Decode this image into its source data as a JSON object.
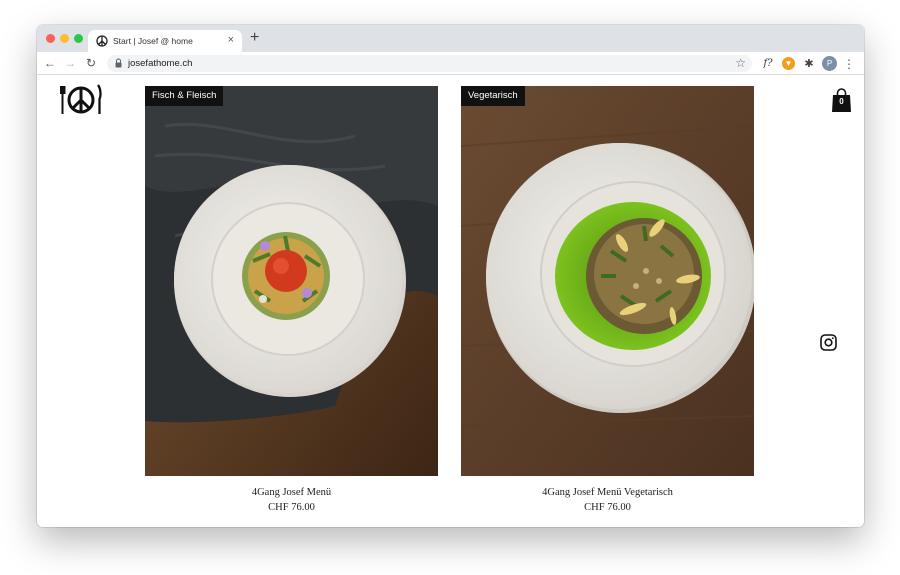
{
  "browser": {
    "tab_title": "Start | Josef @ home",
    "tab_close": "×",
    "new_tab": "+",
    "url": "josefathome.ch",
    "extensions": {
      "fx_label": "f?",
      "avatar_initial": "P"
    }
  },
  "site": {
    "cart_count": "0",
    "products": [
      {
        "category": "Fisch & Fleisch",
        "name": "4Gang Josef Menü",
        "price": "CHF 76.00"
      },
      {
        "category": "Vegetarisch",
        "name": "4Gang Josef Menü Vegetarisch",
        "price": "CHF 76.00"
      }
    ]
  },
  "colors": {
    "tabstrip": "#dee1e6",
    "badge_bg": "#111111",
    "sauce_green": "#6fb31a"
  }
}
